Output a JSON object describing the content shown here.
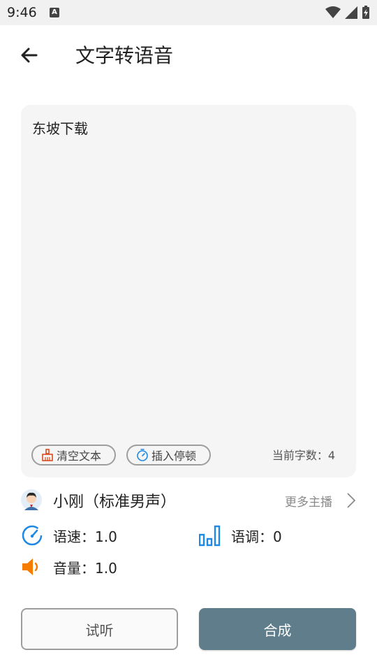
{
  "status_bar": {
    "time": "9:46",
    "notification_letter": "A"
  },
  "header": {
    "title": "文字转语音"
  },
  "editor": {
    "text": "东坡下载",
    "clear_label": "清空文本",
    "insert_pause_label": "插入停顿",
    "char_count_label": "当前字数：4"
  },
  "voice": {
    "name": "小刚（标准男声）",
    "more_label": "更多主播"
  },
  "params": {
    "speed": "语速：1.0",
    "pitch": "语调：0",
    "volume": "音量：1.0"
  },
  "actions": {
    "try_label": "试听",
    "synth_label": "合成"
  },
  "colors": {
    "primary": "#607d8b",
    "speed_icon": "#1e88e5",
    "pitch_icon": "#1e88e5",
    "volume_icon": "#f57c00",
    "clear_icon": "#d84315"
  }
}
